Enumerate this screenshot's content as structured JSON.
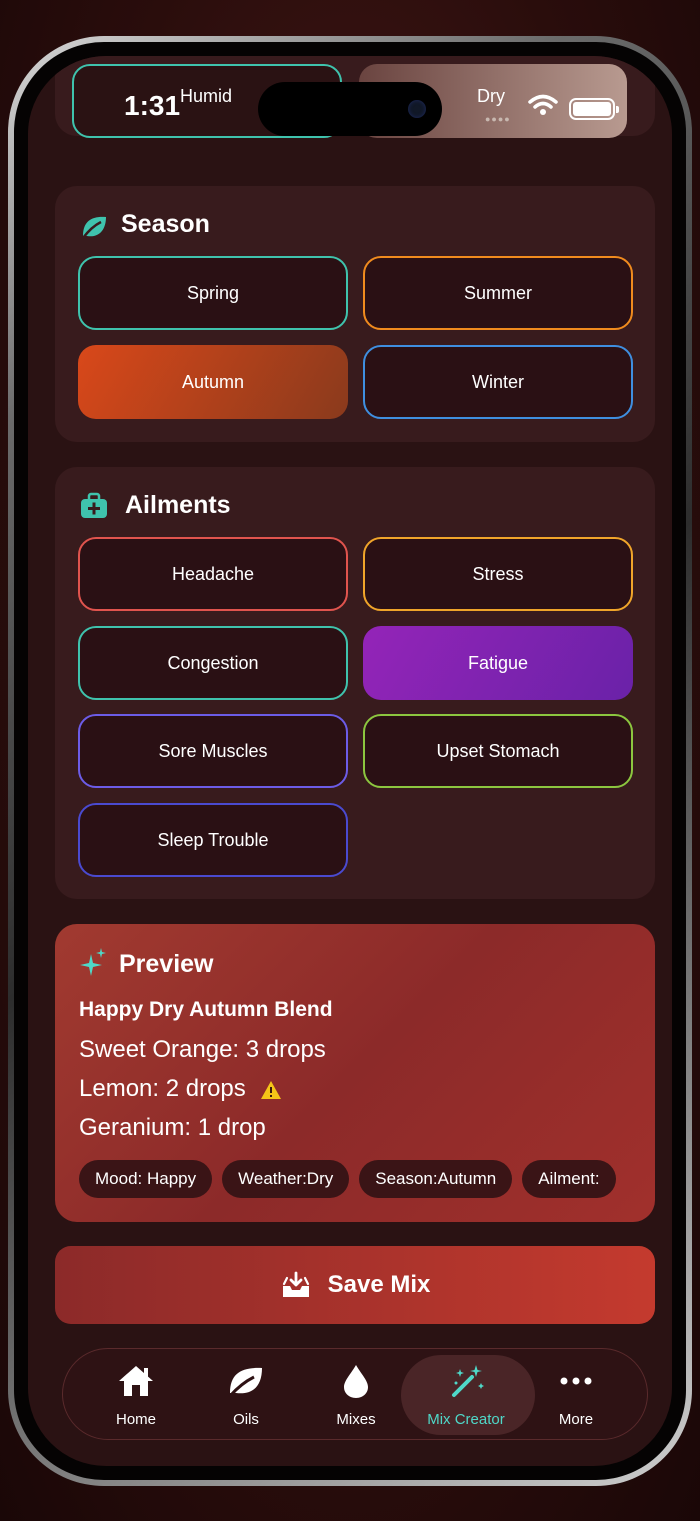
{
  "status": {
    "time": "1:31",
    "left_label": "Humid",
    "right_label": "Dry"
  },
  "season": {
    "title": "Season",
    "options": [
      {
        "label": "Spring",
        "color": "#3fc3ad",
        "selected": false
      },
      {
        "label": "Summer",
        "color": "#f08b1e",
        "selected": false
      },
      {
        "label": "Autumn",
        "color": "#d9481a",
        "selected": true
      },
      {
        "label": "Winter",
        "color": "#3f8fe0",
        "selected": false
      }
    ]
  },
  "ailments": {
    "title": "Ailments",
    "options": [
      {
        "label": "Headache",
        "color": "#e0544e",
        "selected": false
      },
      {
        "label": "Stress",
        "color": "#f0a52a",
        "selected": false
      },
      {
        "label": "Congestion",
        "color": "#3fc3ad",
        "selected": false
      },
      {
        "label": "Fatigue",
        "color": "#8b22b8",
        "selected": true
      },
      {
        "label": "Sore Muscles",
        "color": "#6c5ce7",
        "selected": false
      },
      {
        "label": "Upset Stomach",
        "color": "#8cc63f",
        "selected": false
      },
      {
        "label": "Sleep Trouble",
        "color": "#4a4ad0",
        "selected": false
      }
    ]
  },
  "preview": {
    "title": "Preview",
    "blend_name": "Happy Dry Autumn Blend",
    "ingredients": [
      {
        "text": "Sweet Orange: 3 drops",
        "warning": false
      },
      {
        "text": "Lemon: 2 drops",
        "warning": true
      },
      {
        "text": "Geranium: 1 drop",
        "warning": false
      }
    ],
    "tags": [
      "Mood: Happy",
      "Weather:Dry",
      "Season:Autumn",
      "Ailment:"
    ]
  },
  "save_label": "Save Mix",
  "tabs": [
    {
      "label": "Home",
      "icon": "house-icon",
      "active": false
    },
    {
      "label": "Oils",
      "icon": "leaf-icon",
      "active": false
    },
    {
      "label": "Mixes",
      "icon": "drop-icon",
      "active": false
    },
    {
      "label": "Mix Creator",
      "icon": "magic-wand-icon",
      "active": true
    },
    {
      "label": "More",
      "icon": "ellipsis-icon",
      "active": false
    }
  ],
  "accent_color": "#4fd8c8"
}
